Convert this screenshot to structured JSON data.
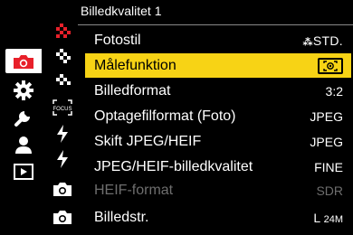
{
  "header": {
    "title": "Billedkvalitet 1"
  },
  "sidebar": {
    "items": [
      {
        "icon": "camera-icon",
        "active": true
      },
      {
        "icon": "gear-icon",
        "active": false
      },
      {
        "icon": "wrench-icon",
        "active": false
      },
      {
        "icon": "person-icon",
        "active": false
      },
      {
        "icon": "playback-icon",
        "active": false
      }
    ]
  },
  "subtabs": [
    {
      "icon": "image-quality-red-icon",
      "active": true
    },
    {
      "icon": "image-quality-icon"
    },
    {
      "icon": "image-quality-icon"
    },
    {
      "icon": "focus-icon",
      "label": "FOCUS"
    },
    {
      "icon": "flash-icon"
    },
    {
      "icon": "flash-icon"
    },
    {
      "icon": "camera-icon"
    },
    {
      "icon": "camera-icon"
    }
  ],
  "menu": {
    "rows": [
      {
        "label": "Fotostil",
        "value": "STD.",
        "value_prefix": "⁂"
      },
      {
        "label": "Målefunktion",
        "value": ""
      },
      {
        "label": "Billedformat",
        "value": "3:2"
      },
      {
        "label": "Optagefilformat (Foto)",
        "value": "JPEG"
      },
      {
        "label": "Skift JPEG/HEIF",
        "value": "JPEG"
      },
      {
        "label": "JPEG/HEIF-billedkvalitet",
        "value": "FINE"
      },
      {
        "label": "HEIF-format",
        "value": "SDR"
      },
      {
        "label": "Billedstr.",
        "value_main": "L",
        "value_sub": "24M"
      }
    ]
  },
  "colors": {
    "accent": "#f7d315",
    "active_red": "#e8202a",
    "disabled": "#6e6e6e"
  }
}
